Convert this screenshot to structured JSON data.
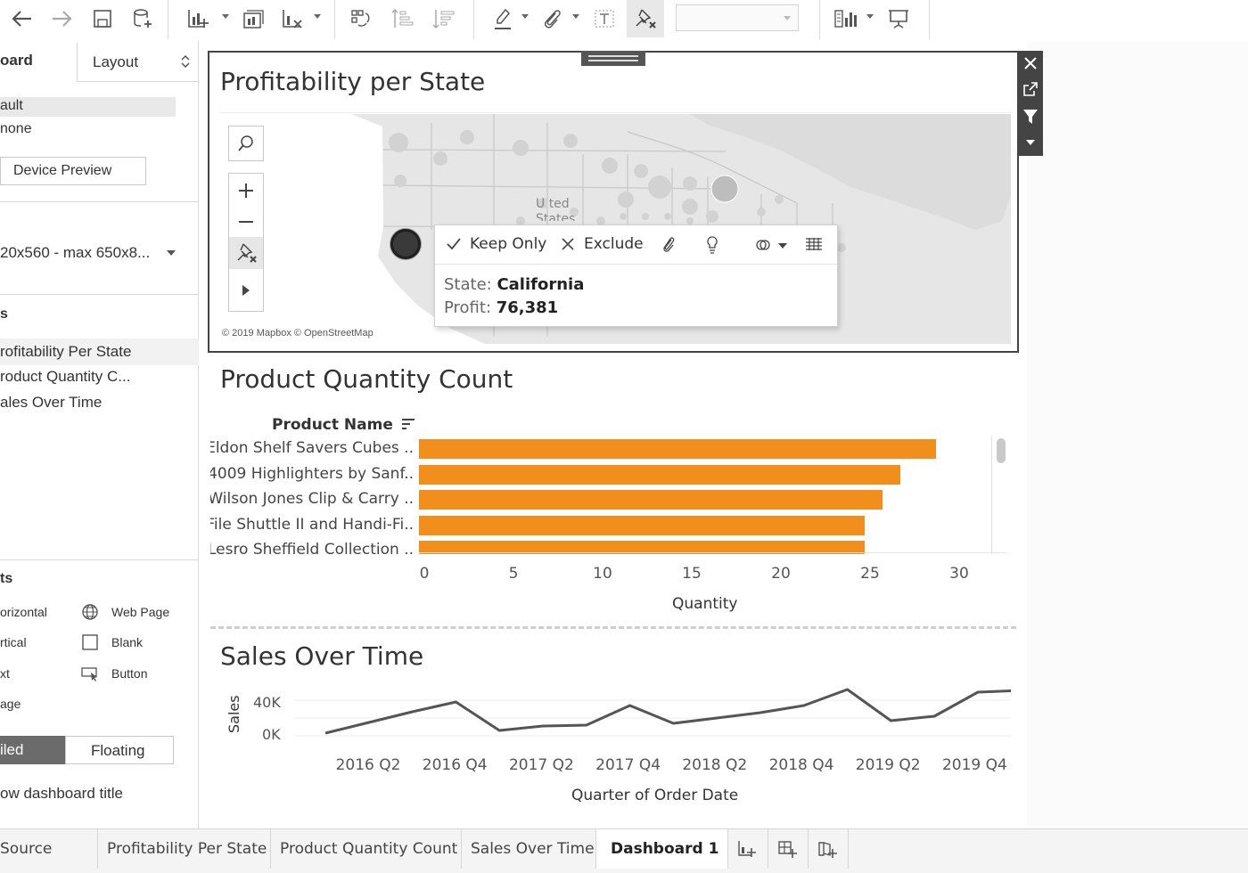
{
  "toolbar": {
    "icons": [
      "back-arrow-icon",
      "forward-arrow-icon",
      "save-icon",
      "new-data-source-icon",
      "new-worksheet-icon",
      "duplicate-icon",
      "clear-sheet-icon",
      "swap-icon",
      "sort-ascending-icon",
      "sort-descending-icon",
      "highlight-icon",
      "annotate-icon",
      "text-icon",
      "pin-clear-icon",
      "presentation-icon"
    ],
    "combo_value": ""
  },
  "left_panel": {
    "tab_dashboard": "oard",
    "tab_layout": "Layout",
    "size_default": "ault",
    "size_phone": "none",
    "device_preview": "Device Preview",
    "size_range": "20x560 - max 650x8...",
    "sheets_header": "s",
    "sheets": [
      "rofitability Per State",
      "roduct Quantity C...",
      "ales Over Time"
    ],
    "objects_header": "ts",
    "objects": [
      {
        "left": "orizontal",
        "right": "Web Page",
        "right_icon": "globe-icon"
      },
      {
        "left": "rtical",
        "right": "Blank",
        "right_icon": "blank-icon"
      },
      {
        "left": "xt",
        "right": "Button",
        "right_icon": "button-icon"
      },
      {
        "left": "age",
        "right": "",
        "right_icon": ""
      }
    ],
    "tiled": "iled",
    "floating": "Floating",
    "show_title": "ow dashboard title"
  },
  "map": {
    "title": "Profitability per State",
    "map_label_line1": "U  ted",
    "map_label_line2": "States",
    "attribution": "© 2019 Mapbox © OpenStreetMap",
    "tooltip": {
      "keep_only": "Keep Only",
      "exclude": "Exclude",
      "state_key": "State:",
      "state_value": "California",
      "profit_key": "Profit:",
      "profit_value": "76,381"
    }
  },
  "bar_zone": {
    "title": "Product Quantity Count",
    "column_header": "Product Name",
    "axis_title": "Quantity"
  },
  "line_zone": {
    "title": "Sales Over Time",
    "y_title": "Sales",
    "x_title": "Quarter of Order Date"
  },
  "chart_data": [
    {
      "type": "bar",
      "title": "Product Quantity Count",
      "ylabel": "Product Name",
      "xlabel": "Quantity",
      "categories": [
        "Eldon Shelf Savers Cubes ..",
        "4009 Highlighters by Sanf..",
        "Wilson Jones Clip & Carry ..",
        "File Shuttle II and Handi-Fi..",
        "Lesro Sheffield Collection .."
      ],
      "values": [
        29,
        27,
        26,
        25,
        25
      ],
      "xlim": [
        0,
        31
      ],
      "ticks": [
        0,
        5,
        10,
        15,
        20,
        25,
        30
      ],
      "color": "#f28e1c"
    },
    {
      "type": "line",
      "title": "Sales Over Time",
      "xlabel": "Quarter of Order Date",
      "ylabel": "Sales",
      "x": [
        "2016 Q1",
        "2016 Q2",
        "2016 Q3",
        "2016 Q4",
        "2017 Q1",
        "2017 Q2",
        "2017 Q3",
        "2017 Q4",
        "2018 Q1",
        "2018 Q2",
        "2018 Q3",
        "2018 Q4",
        "2019 Q1",
        "2019 Q2",
        "2019 Q3",
        "2019 Q4"
      ],
      "x_tick_labels": [
        "2016 Q2",
        "2016 Q4",
        "2017 Q2",
        "2017 Q4",
        "2018 Q2",
        "2018 Q4",
        "2019 Q2",
        "2019 Q4"
      ],
      "values": [
        3000,
        15000,
        27000,
        38000,
        6000,
        11000,
        12000,
        34000,
        14000,
        20000,
        26000,
        34000,
        52000,
        17000,
        22000,
        49000,
        51000
      ],
      "y_ticks": [
        "40K",
        "0K"
      ],
      "ylim": [
        0,
        55000
      ],
      "color": "#555555"
    }
  ],
  "tabs": [
    "Source",
    "Profitability Per State",
    "Product Quantity Count",
    "Sales Over Time",
    "Dashboard 1"
  ]
}
